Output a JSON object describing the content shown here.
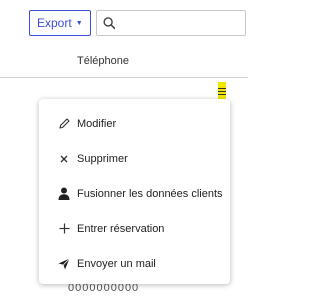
{
  "toolbar": {
    "export_label": "Export",
    "search_value": ""
  },
  "table": {
    "column_phone": "Téléphone",
    "next_row_phone_peek": "0000000000"
  },
  "row_menu": {
    "trigger_icon": "hamburger-icon",
    "items": [
      {
        "label": "Modifier",
        "icon": "pencil-icon"
      },
      {
        "label": "Supprimer",
        "icon": "close-icon"
      },
      {
        "label": "Fusionner les données clients",
        "icon": "person-icon"
      },
      {
        "label": "Entrer réservation",
        "icon": "plus-icon"
      },
      {
        "label": "Envoyer un mail",
        "icon": "send-icon"
      }
    ]
  },
  "colors": {
    "accent": "#3b4fd8",
    "highlight": "#f2e600"
  }
}
